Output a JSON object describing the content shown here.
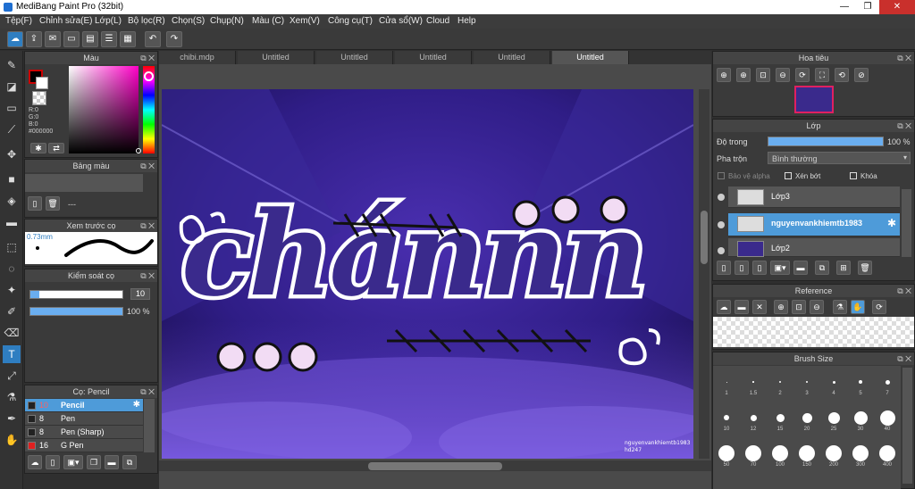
{
  "window": {
    "title": "MediBang Paint Pro (32bit)",
    "minimize": "—",
    "maximize": "❐",
    "close": "✕"
  },
  "menu": [
    "Tệp(F)",
    "Chỉnh sửa(E)",
    "Lớp(L)",
    "Bộ lọc(R)",
    "Chọn(S)",
    "Chụp(N)",
    "Màu (C)",
    "Xem(V)",
    "Công cụ(T)",
    "Cửa sổ(W)",
    "Cloud",
    "Help"
  ],
  "color_panel": {
    "title": "Màu",
    "r": "R:0",
    "g": "G:0",
    "b": "B:0",
    "hex": "#000000"
  },
  "palette_panel": {
    "title": "Bảng màu",
    "placeholder": "---"
  },
  "brush_preview": {
    "title": "Xem trước cọ",
    "size": "0.73mm"
  },
  "brush_control": {
    "title": "Kiểm soát cọ",
    "size": "10",
    "opacity": "100 %",
    "size_fraction": 0.1,
    "opacity_fraction": 1.0
  },
  "brush_list": {
    "title": "Cọ: Pencil",
    "items": [
      {
        "size": "10",
        "name": "Pencil",
        "color": "#222222"
      },
      {
        "size": "8",
        "name": "Pen",
        "color": "#222222"
      },
      {
        "size": "8",
        "name": "Pen (Sharp)",
        "color": "#222222"
      },
      {
        "size": "16",
        "name": "G Pen",
        "color": "#e02020"
      }
    ]
  },
  "tabs": [
    "chibi.mdp",
    "Untitled",
    "Untitled",
    "Untitled",
    "Untitled",
    "Untitled"
  ],
  "canvas": {
    "lettering": "chánnn",
    "watermark_line1": "nguyenvankhiemtb1983",
    "watermark_line2": "hd247"
  },
  "navigator": {
    "title": "Hoa tiêu"
  },
  "layers": {
    "title": "Lớp",
    "opacity_label": "Độ trong",
    "opacity_value": "100 %",
    "opacity_fraction": 1.0,
    "blend_label": "Pha trộn",
    "blend_value": "Bình thường",
    "protect_alpha": "Bảo vệ alpha",
    "clipping": "Xén bớt",
    "lock": "Khóa",
    "items": [
      {
        "name": "Lớp3"
      },
      {
        "name": "nguyenvankhiemtb1983"
      },
      {
        "name": "Lớp2"
      }
    ]
  },
  "reference": {
    "title": "Reference"
  },
  "brush_size": {
    "title": "Brush Size",
    "row1": [
      "1",
      "1.5",
      "2",
      "3",
      "4",
      "5",
      "7"
    ],
    "row2": [
      "10",
      "12",
      "15",
      "20",
      "25",
      "30",
      "40"
    ],
    "row3": [
      "50",
      "70",
      "100",
      "150",
      "200",
      "300",
      "400"
    ]
  },
  "colors": {
    "accent": "#4e9bd9",
    "canvas_bg": "#2b1a6e",
    "lettering_fill": "#3a2a8c"
  }
}
